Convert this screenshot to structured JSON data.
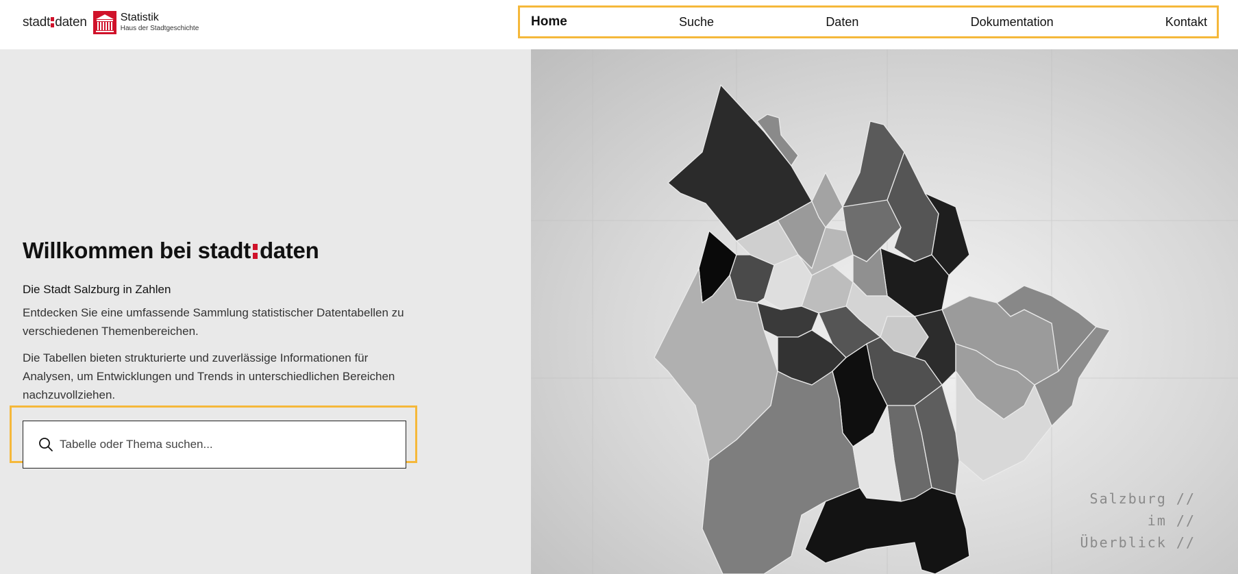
{
  "header": {
    "logo": {
      "word_left": "stadt",
      "word_right": "daten",
      "title": "Statistik",
      "subtitle": "Haus der Stadtgeschichte"
    },
    "nav": [
      {
        "label": "Home",
        "active": true
      },
      {
        "label": "Suche",
        "active": false
      },
      {
        "label": "Daten",
        "active": false
      },
      {
        "label": "Dokumentation",
        "active": false
      },
      {
        "label": "Kontakt",
        "active": false
      }
    ]
  },
  "hero": {
    "title_prefix": "Willkommen bei stadt",
    "title_suffix": "daten",
    "subtitle": "Die Stadt Salzburg in Zahlen",
    "paragraph1": "Entdecken Sie eine umfassende Sammlung statistischer Datentabellen zu verschiedenen Themenbereichen.",
    "paragraph2": "Die Tabellen bieten strukturierte und zuverlässige Informationen für Analysen, um Entwicklungen und Trends in unterschiedlichen Bereichen nachzuvollziehen.",
    "search": {
      "placeholder": "Tabelle oder Thema suchen...",
      "value": ""
    }
  },
  "map": {
    "overlay_lines": [
      "Salzburg //",
      "im //",
      "Überblick //"
    ]
  },
  "colors": {
    "accent": "#d0122a",
    "highlight": "#f5b83a",
    "panel_bg": "#e9e9e9"
  }
}
